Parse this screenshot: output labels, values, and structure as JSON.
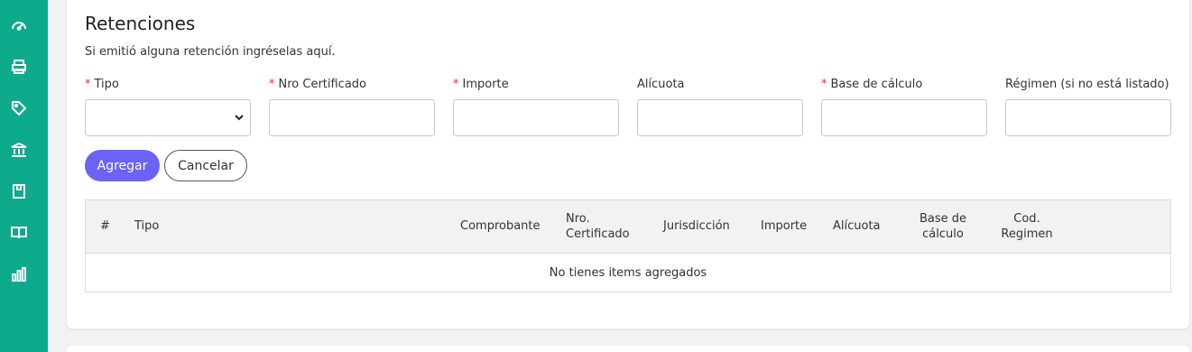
{
  "sidebar": {
    "items": [
      {
        "icon": "dashboard-gauge-icon"
      },
      {
        "icon": "printer-icon"
      },
      {
        "icon": "tag-icon"
      },
      {
        "icon": "bank-icon"
      },
      {
        "icon": "package-icon"
      },
      {
        "icon": "open-book-icon"
      },
      {
        "icon": "bar-chart-icon"
      }
    ]
  },
  "section": {
    "title": "Retenciones",
    "subtitle": "Si emitió alguna retención ingréselas aquí."
  },
  "form": {
    "required_mark": "*",
    "fields": [
      {
        "label": "Tipo",
        "required": true,
        "type": "select",
        "value": ""
      },
      {
        "label": "Nro Certificado",
        "required": true,
        "type": "text",
        "value": ""
      },
      {
        "label": "Importe",
        "required": true,
        "type": "text",
        "value": ""
      },
      {
        "label": "Alícuota",
        "required": false,
        "type": "text",
        "value": ""
      },
      {
        "label": "Base de cálculo",
        "required": true,
        "type": "text",
        "value": ""
      },
      {
        "label": "Régimen (si no está listado)",
        "required": false,
        "type": "text",
        "value": ""
      }
    ],
    "add_label": "Agregar",
    "cancel_label": "Cancelar"
  },
  "table": {
    "headers": {
      "num": "#",
      "tipo": "Tipo",
      "comprobante": "Comprobante",
      "nro_cert_1": "Nro.",
      "nro_cert_2": "Certificado",
      "jurisdiccion": "Jurisdicción",
      "importe": "Importe",
      "alicuota": "Alícuota",
      "base_1": "Base de",
      "base_2": "cálculo",
      "cod_1": "Cod.",
      "cod_2": "Regimen"
    },
    "empty_text": "No tienes items agregados"
  },
  "colors": {
    "sidebar": "#0eaa8c",
    "primary_button": "#6b63f5",
    "required": "#e0303b"
  }
}
